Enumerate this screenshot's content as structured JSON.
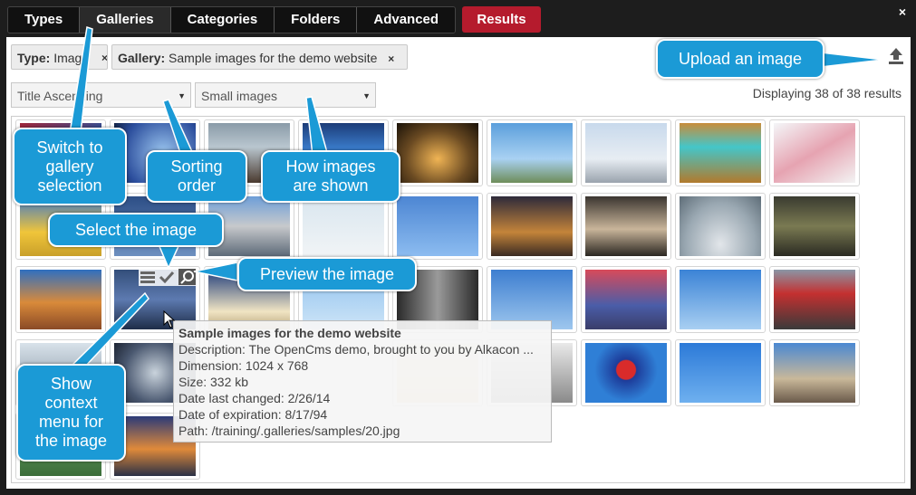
{
  "tabs": [
    {
      "label": "Types"
    },
    {
      "label": "Galleries"
    },
    {
      "label": "Categories"
    },
    {
      "label": "Folders"
    },
    {
      "label": "Advanced"
    }
  ],
  "results_tab": "Results",
  "close_label": "×",
  "filters": {
    "type_key": "Type:",
    "type_value": "Imag",
    "gallery_key": "Gallery:",
    "gallery_value": "Sample images for the demo website",
    "remove_label": "×"
  },
  "sort_select": "Title Ascending",
  "display_select": "Small images",
  "results_count": "Displaying 38 of 38 results",
  "callouts": {
    "upload": "Upload an image",
    "switch_gallery": [
      "Switch to",
      "gallery",
      "selection"
    ],
    "sorting": [
      "Sorting",
      "order"
    ],
    "how_shown": [
      "How images",
      "are shown"
    ],
    "select_image": "Select the image",
    "preview_image": "Preview the image",
    "context_menu": [
      "Show",
      "context",
      "menu for",
      "the image"
    ]
  },
  "tooltip": {
    "title": "Sample images for the demo website",
    "description": "Description: The OpenCms demo, brought to you by Alkacon ...",
    "dimension": "Dimension: 1024 x 768",
    "size": "Size: 332 kb",
    "last_changed": "Date last changed: 2/26/14",
    "expiration": "Date of expiration: 8/17/94",
    "path": "Path: /training/.galleries/samples/20.jpg"
  },
  "colors": {
    "accent_blue": "#1b9ad6",
    "results_red": "#b51b2d",
    "window_dark": "#1d1d1d"
  },
  "icons": [
    "upload-icon",
    "close-icon",
    "menu-icon",
    "check-icon",
    "zoom-icon",
    "chevron-down-icon",
    "cursor-icon"
  ]
}
